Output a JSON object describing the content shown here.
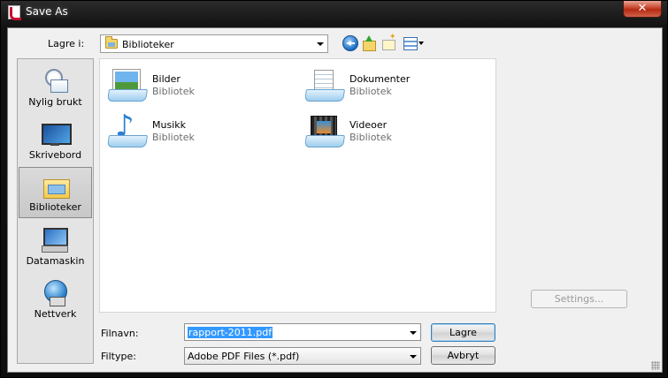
{
  "window": {
    "title": "Save As",
    "close_glyph": "✕"
  },
  "toolbar": {
    "look_in_label": "Lagre i:",
    "look_in_value": "Biblioteker",
    "icons": [
      "back-icon",
      "up-folder-icon",
      "new-folder-icon",
      "views-menu-icon"
    ]
  },
  "places": [
    {
      "label": "Nylig brukt",
      "icon": "recent-places-icon",
      "selected": false
    },
    {
      "label": "Skrivebord",
      "icon": "desktop-icon",
      "selected": false
    },
    {
      "label": "Biblioteker",
      "icon": "libraries-icon",
      "selected": true
    },
    {
      "label": "Datamaskin",
      "icon": "computer-icon",
      "selected": false
    },
    {
      "label": "Nettverk",
      "icon": "network-icon",
      "selected": false
    }
  ],
  "libraries": [
    {
      "name": "Bilder",
      "type": "Bibliotek",
      "icon": "pictures-library-icon"
    },
    {
      "name": "Dokumenter",
      "type": "Bibliotek",
      "icon": "documents-library-icon"
    },
    {
      "name": "Musikk",
      "type": "Bibliotek",
      "icon": "music-library-icon"
    },
    {
      "name": "Videoer",
      "type": "Bibliotek",
      "icon": "videos-library-icon"
    }
  ],
  "form": {
    "filename_label": "Filnavn:",
    "filename_value": "rapport-2011.pdf",
    "filetype_label": "Filtype:",
    "filetype_value": "Adobe PDF Files (*.pdf)"
  },
  "buttons": {
    "save": "Lagre",
    "cancel": "Avbryt",
    "settings": "Settings..."
  },
  "colors": {
    "selection": "#3399ff",
    "close_button": "#c7432b",
    "secondary_text": "#6d6d6d"
  }
}
